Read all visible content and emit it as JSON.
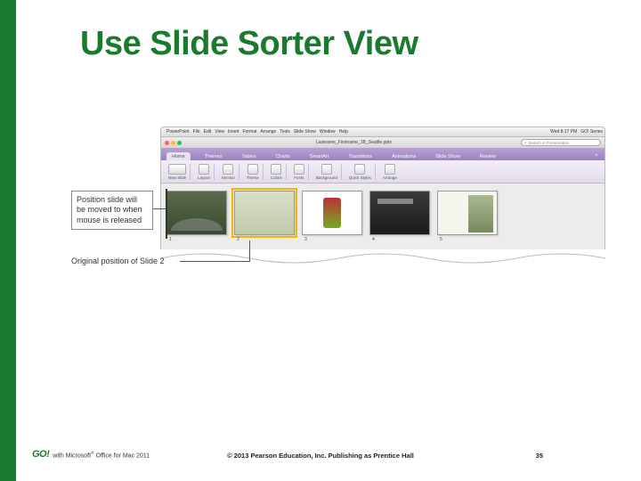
{
  "title": "Use Slide Sorter View",
  "mac_menu": {
    "apple": "",
    "items": [
      "PowerPoint",
      "File",
      "Edit",
      "View",
      "Insert",
      "Format",
      "Arrange",
      "Tools",
      "Slide Show",
      "Window",
      "Help"
    ],
    "clock": "Wed 8:17 PM",
    "user": "GO! Series"
  },
  "window": {
    "document_name": "Lastname_Firstname_1B_Seattle.pptx",
    "search_placeholder": "Search in Presentation"
  },
  "ribbon": {
    "tabs": [
      "Home",
      "Themes",
      "Tables",
      "Charts",
      "SmartArt",
      "Transitions",
      "Animations",
      "Slide Show",
      "Review"
    ],
    "active_tab": "Home",
    "groups": [
      {
        "icon": "new-slide",
        "label": "New Slide"
      },
      {
        "icon": "layout",
        "label": "Layout"
      },
      {
        "icon": "section",
        "label": "Section"
      },
      {
        "icon": "theme",
        "label": "Theme"
      },
      {
        "icon": "colors",
        "label": "Colors"
      },
      {
        "icon": "fonts",
        "label": "Fonts"
      },
      {
        "icon": "background",
        "label": "Background"
      },
      {
        "icon": "quick-styles",
        "label": "Quick Styles"
      },
      {
        "icon": "arrange",
        "label": "Arrange"
      }
    ]
  },
  "sorter": {
    "slides": [
      {
        "num": "1"
      },
      {
        "num": "2"
      },
      {
        "num": "3"
      },
      {
        "num": "4"
      },
      {
        "num": "5"
      }
    ],
    "selected_index": 1
  },
  "callouts": {
    "drop_target": "Position slide will be moved to when mouse is released",
    "original_pos": "Original position of Slide 2"
  },
  "footer": {
    "logo": "GO!",
    "product_line": "with Microsoft® Office for Mac 2011",
    "copyright": "© 2013 Pearson Education, Inc. Publishing as Prentice Hall",
    "page": "35"
  }
}
